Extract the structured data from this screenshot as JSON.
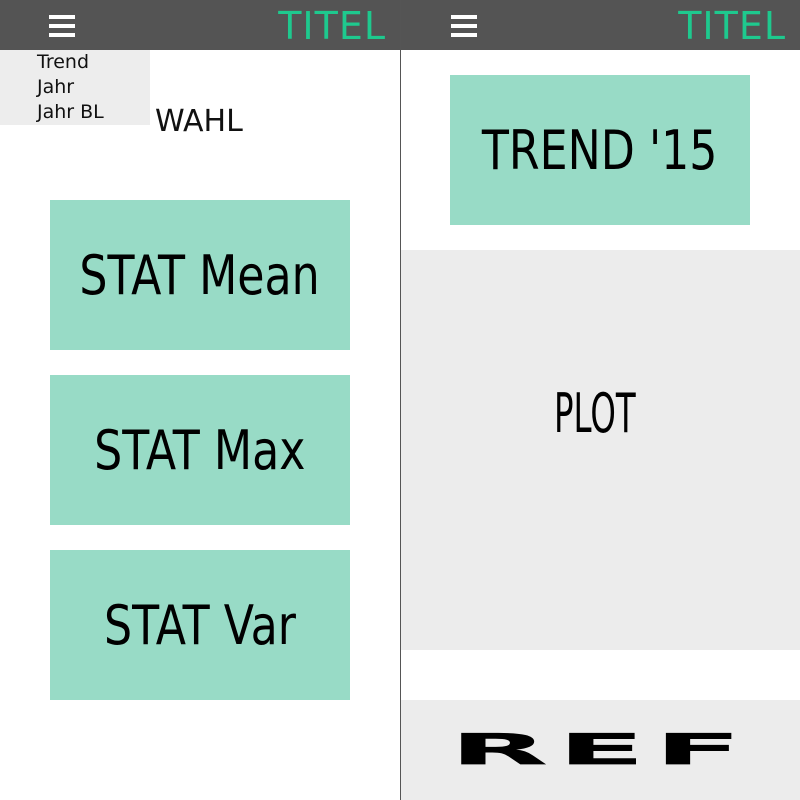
{
  "left": {
    "header": {
      "title": "TITEL"
    },
    "menu": {
      "items": [
        "Trend",
        "Jahr",
        "Jahr BL"
      ]
    },
    "selection_label": "WAHL",
    "tiles": [
      "STAT Mean",
      "STAT Max",
      "STAT Var"
    ]
  },
  "right": {
    "header": {
      "title": "TITEL"
    },
    "trend_tile": "TREND '15",
    "plot_label": "PLOT",
    "ref_label": "REF"
  },
  "colors": {
    "header_bg": "#545454",
    "title": "#1ec98e",
    "tile_bg": "#98dbc6",
    "panel_gray": "#ececec"
  },
  "icons": [
    "menu-icon"
  ]
}
